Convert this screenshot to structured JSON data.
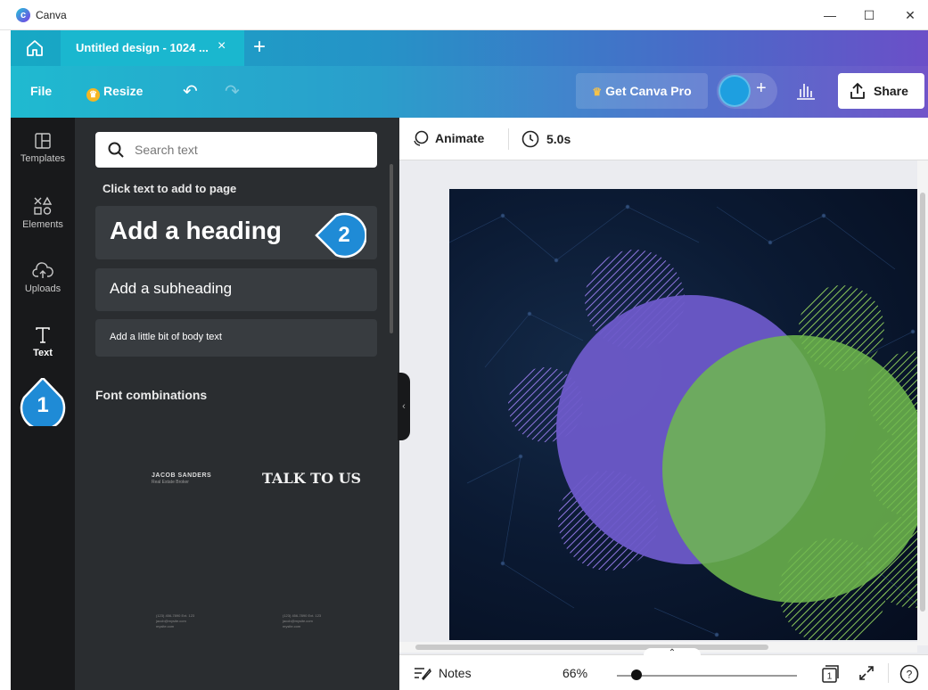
{
  "window": {
    "app_title": "Canva",
    "minimize": "—",
    "maximize": "☐",
    "close": "✕"
  },
  "tabs": {
    "active_label": "Untitled design - 1024 ...",
    "close": "×",
    "new_tab": "+"
  },
  "toolbar": {
    "file_label": "File",
    "resize_label": "Resize",
    "undo": "↶",
    "redo": "↷",
    "pro_label": "Get Canva Pro",
    "add_people": "+",
    "share_label": "Share"
  },
  "sidenav": {
    "items": [
      {
        "label": "Templates"
      },
      {
        "label": "Elements"
      },
      {
        "label": "Uploads"
      },
      {
        "label": "Text"
      }
    ]
  },
  "panel": {
    "search_placeholder": "Search text",
    "hint": "Click text to add to page",
    "heading": "Add a heading",
    "subheading": "Add a subheading",
    "body": "Add a little bit of body text",
    "font_combinations_title": "Font combinations",
    "combo_a_title": "JACOB SANDERS",
    "combo_a_sub": "Real Estate Broker",
    "combo_b": "TALK TO US",
    "combo_small_1": "(123) 456-7890 Ext. 123\njacob@mysite.com\nmysite.com",
    "combo_small_2": "(123) 456-7890 Ext. 123\njacob@mysite.com\nmysite.com",
    "collapse": "‹"
  },
  "editor": {
    "animate_label": "Animate",
    "duration": "5.0s",
    "pages_toggle": "⌃",
    "notes_label": "Notes",
    "zoom": "66%",
    "zoom_fraction": 0.1,
    "page_number": "1",
    "help": "?"
  },
  "callouts": {
    "one": "1",
    "two": "2"
  },
  "colors": {
    "accent_teal": "#1ab7cf",
    "accent_purple": "#6b4fc8",
    "panel_bg": "#2a2d30",
    "callout_blue": "#1f8bd6"
  }
}
